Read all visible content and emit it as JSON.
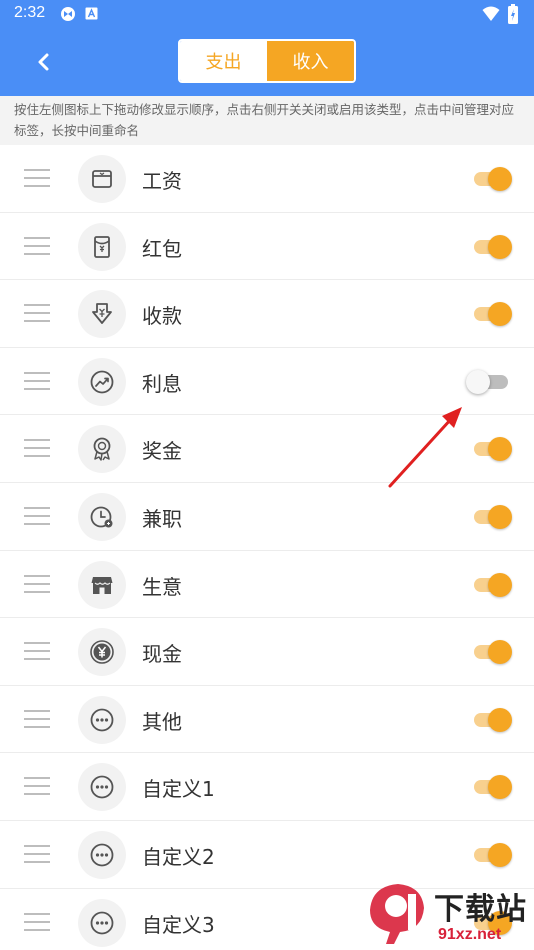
{
  "status_bar": {
    "time": "2:32",
    "icons": [
      "app-notification-icon",
      "a-box-icon",
      "wifi-icon",
      "battery-icon"
    ]
  },
  "header": {
    "back_icon": "chevron-left-icon",
    "tabs": [
      {
        "label": "支出",
        "selected": false
      },
      {
        "label": "收入",
        "selected": true
      }
    ]
  },
  "hint": "按住左侧图标上下拖动修改显示顺序，点击右侧开关关闭或启用该类型，点击中间管理对应标签，长按中间重命名",
  "categories": [
    {
      "label": "工资",
      "icon": "wallet-icon",
      "enabled": true
    },
    {
      "label": "红包",
      "icon": "red-envelope-icon",
      "enabled": true
    },
    {
      "label": "收款",
      "icon": "receive-money-icon",
      "enabled": true
    },
    {
      "label": "利息",
      "icon": "trend-up-icon",
      "enabled": false
    },
    {
      "label": "奖金",
      "icon": "award-ribbon-icon",
      "enabled": true
    },
    {
      "label": "兼职",
      "icon": "clock-icon",
      "enabled": true
    },
    {
      "label": "生意",
      "icon": "shop-icon",
      "enabled": true
    },
    {
      "label": "现金",
      "icon": "yen-coin-icon",
      "enabled": true
    },
    {
      "label": "其他",
      "icon": "more-dots-icon",
      "enabled": true
    },
    {
      "label": "自定义1",
      "icon": "more-dots-icon",
      "enabled": true
    },
    {
      "label": "自定义2",
      "icon": "more-dots-icon",
      "enabled": true
    },
    {
      "label": "自定义3",
      "icon": "more-dots-icon",
      "enabled": true
    }
  ],
  "watermark": {
    "top": "下载站",
    "bottom": "91xz.net"
  },
  "colors": {
    "primary_blue": "#4a8ef6",
    "accent_orange": "#f5a623",
    "annotation_red": "#e02020"
  }
}
